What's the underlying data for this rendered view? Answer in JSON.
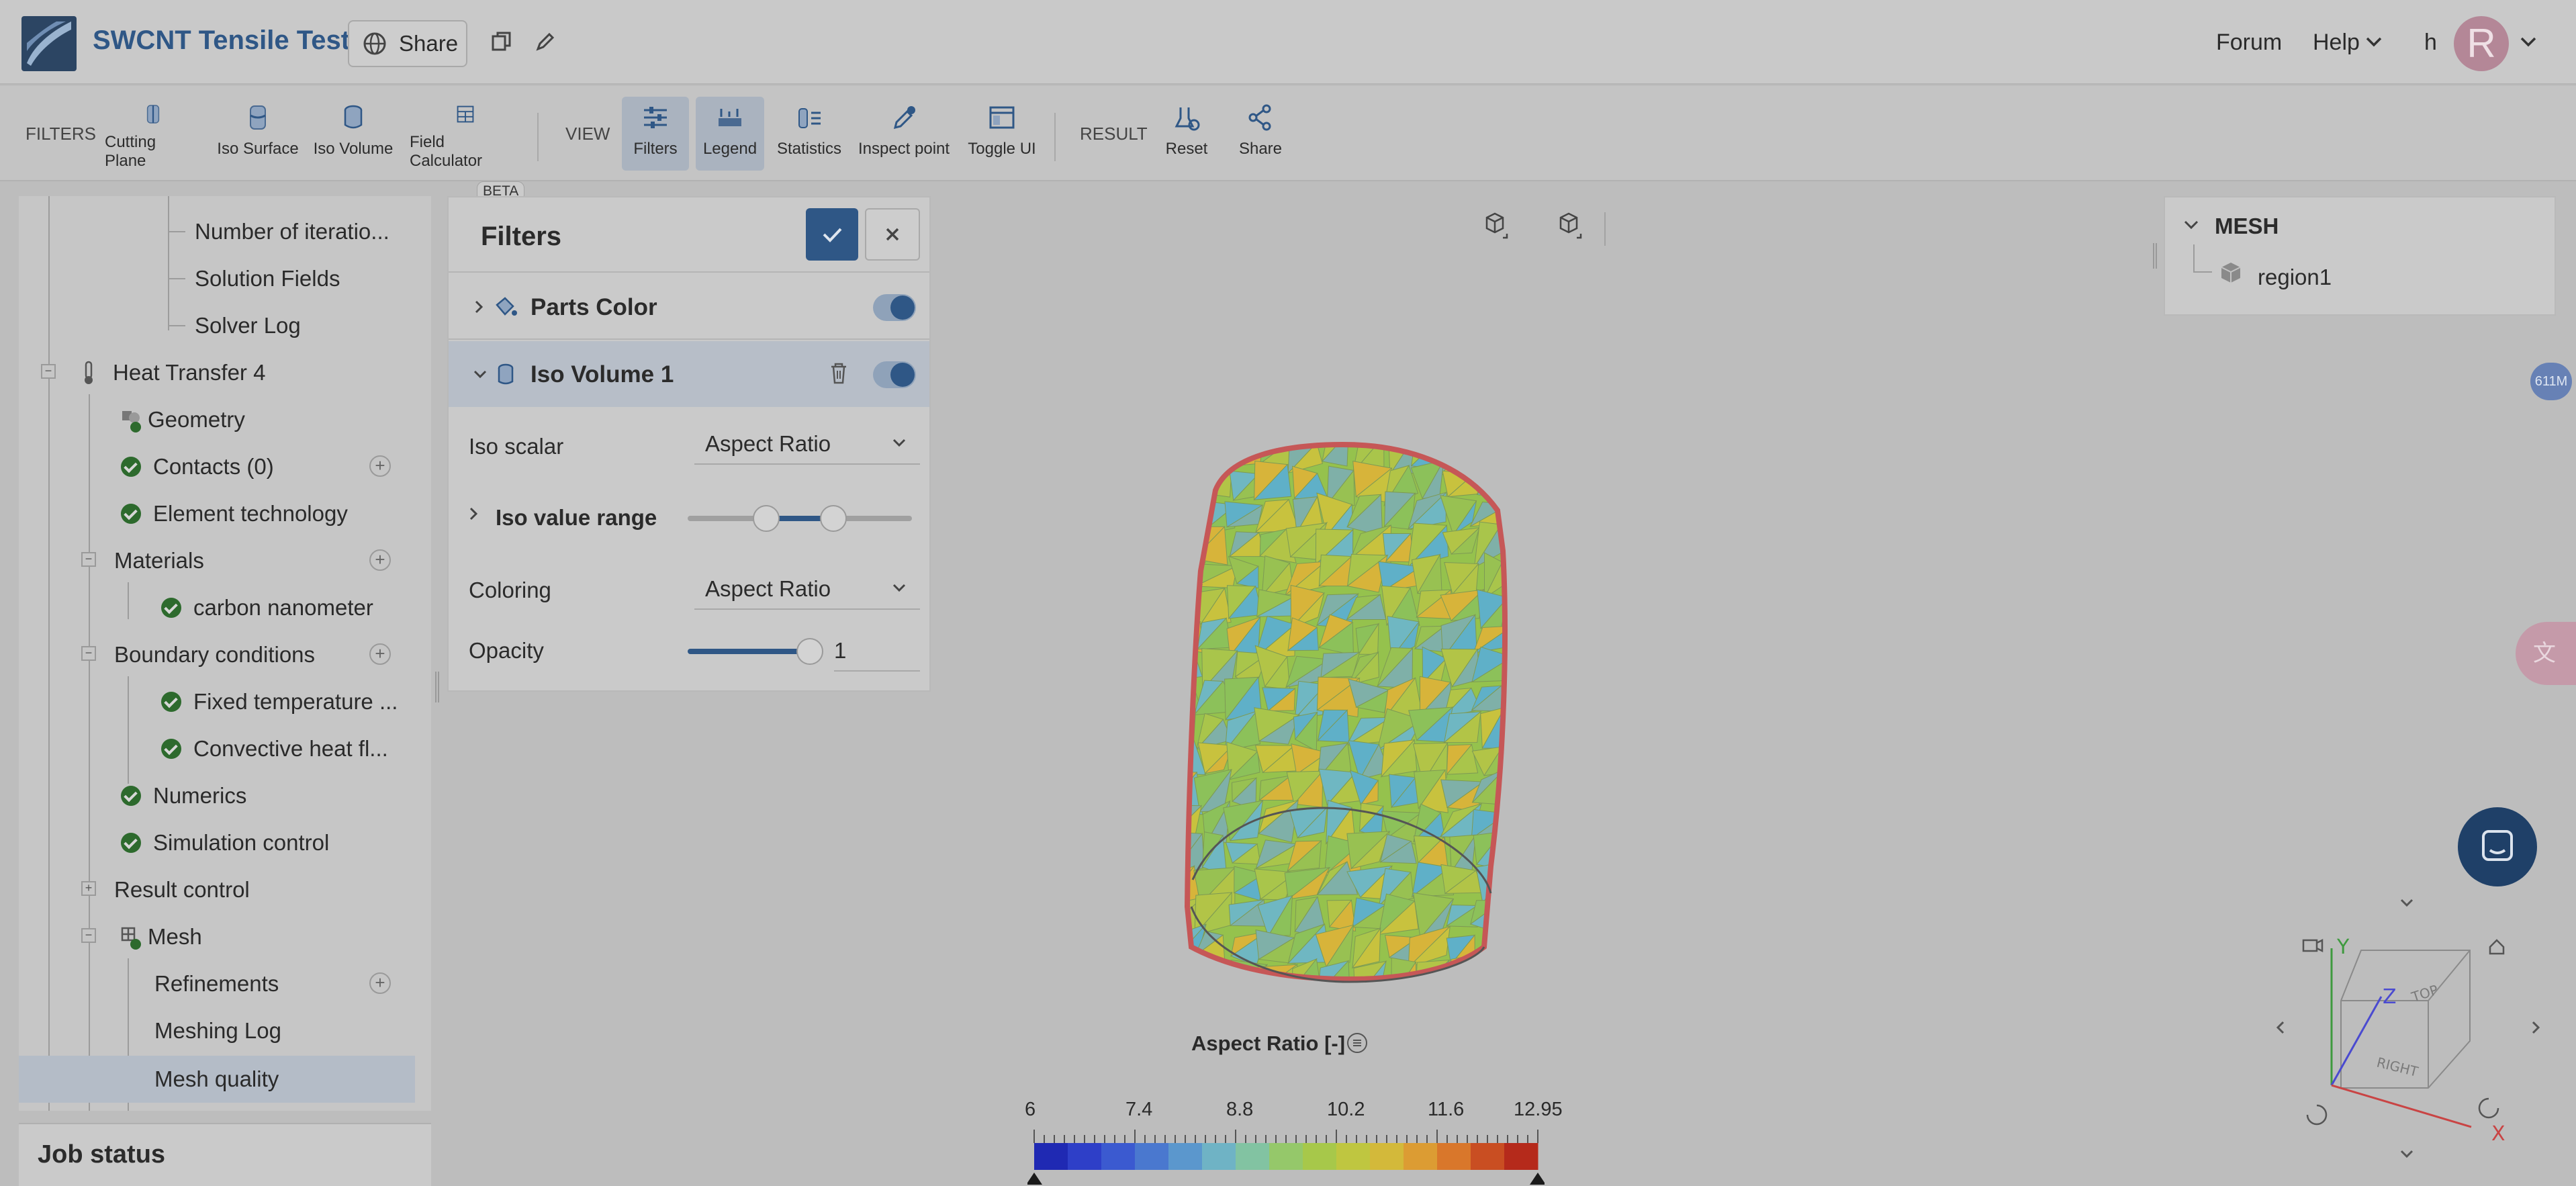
{
  "header": {
    "title": "SWCNT Tensile Test",
    "share_label": "Share",
    "links": {
      "forum": "Forum",
      "help": "Help",
      "user_initial": "h"
    },
    "avatar_letter": "R"
  },
  "toolbar": {
    "groups": {
      "filters": "FILTERS",
      "view": "VIEW",
      "result": "RESULT"
    },
    "beta_badge": "BETA",
    "items": {
      "cutting_plane": "Cutting Plane",
      "iso_surface": "Iso Surface",
      "iso_volume": "Iso Volume",
      "field_calculator": "Field Calculator",
      "filters": "Filters",
      "legend": "Legend",
      "statistics": "Statistics",
      "inspect_point": "Inspect point",
      "toggle_ui": "Toggle UI",
      "reset": "Reset",
      "share": "Share"
    }
  },
  "tree": {
    "items": {
      "number_of_iterations": "Number of iteratio...",
      "solution_fields": "Solution Fields",
      "solver_log": "Solver Log",
      "heat_transfer": "Heat Transfer 4",
      "geometry": "Geometry",
      "contacts": "Contacts (0)",
      "element_technology": "Element technology",
      "materials": "Materials",
      "carbon": "carbon nanometer",
      "boundary_conditions": "Boundary conditions",
      "fixed_temp": "Fixed temperature ...",
      "convective": "Convective heat fl...",
      "numerics": "Numerics",
      "simulation_control": "Simulation control",
      "result_control": "Result control",
      "mesh": "Mesh",
      "refinements": "Refinements",
      "meshing_log": "Meshing Log",
      "mesh_quality": "Mesh quality"
    },
    "job_status": "Job status"
  },
  "filters_panel": {
    "title": "Filters",
    "parts_color": "Parts Color",
    "iso_volume": "Iso Volume 1",
    "iso_scalar_label": "Iso scalar",
    "iso_scalar_value": "Aspect Ratio",
    "iso_value_range_label": "Iso value range",
    "iso_value_range": {
      "low_fraction": 0.35,
      "high_fraction": 0.65
    },
    "coloring_label": "Coloring",
    "coloring_value": "Aspect Ratio",
    "opacity_label": "Opacity",
    "opacity_value": "1"
  },
  "mesh_panel": {
    "title": "MESH",
    "region": "region1"
  },
  "colorbar": {
    "title": "Aspect Ratio [-]",
    "ticks": [
      "6",
      "7.4",
      "8.8",
      "10.2",
      "11.6",
      "12.95"
    ],
    "colors": [
      "#1f29b3",
      "#2e3fc8",
      "#3b5ad0",
      "#4a78cf",
      "#5b97cd",
      "#6fb3c5",
      "#82c3a2",
      "#95c86a",
      "#a7c84a",
      "#bfc640",
      "#d3b93a",
      "#dc9c33",
      "#d9772b",
      "#c94e22",
      "#b52a1b"
    ]
  },
  "orientation_cube": {
    "faces": [
      "TOP",
      "RIGHT"
    ],
    "axes": [
      "Z",
      "Y",
      "X"
    ]
  },
  "memory_badge": "611M",
  "accent_color": "#2f5786"
}
